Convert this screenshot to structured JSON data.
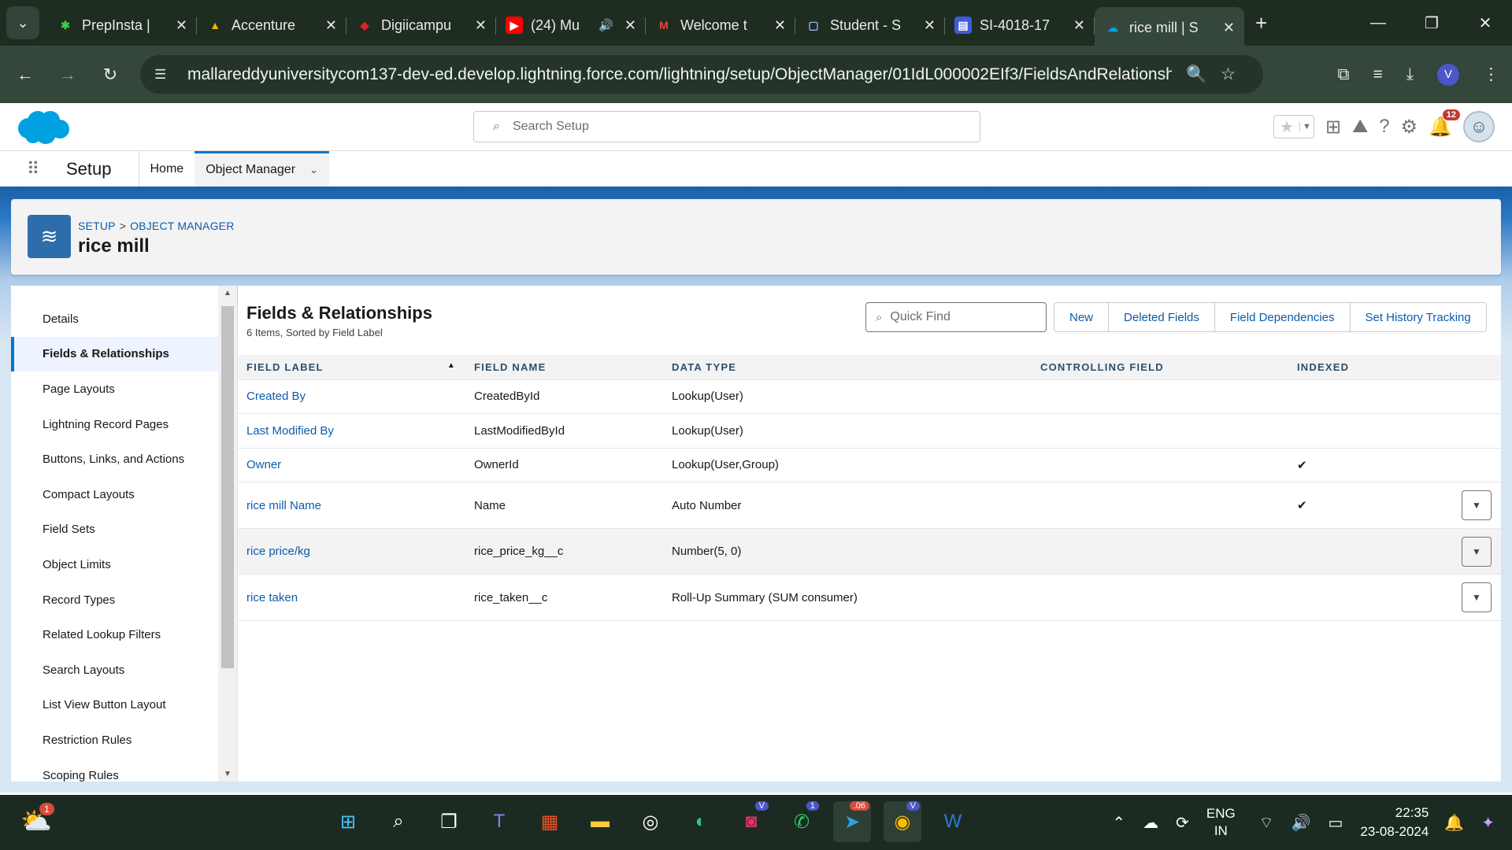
{
  "browser": {
    "tabs": [
      {
        "label": "PrepInsta |",
        "fav": "✱",
        "fav_color": "#3ecf4a",
        "fav_bg": "transparent"
      },
      {
        "label": "Accenture",
        "fav": "▲",
        "fav_color": "#f4b400",
        "fav_bg": "transparent"
      },
      {
        "label": "Digiicampu",
        "fav": "◆",
        "fav_color": "#e01e2a",
        "fav_bg": "transparent"
      },
      {
        "label": "(24) Mu",
        "fav": "▶",
        "fav_color": "#ffffff",
        "fav_bg": "#ff0000",
        "audio": "🔊"
      },
      {
        "label": "Welcome t",
        "fav": "M",
        "fav_color": "#ea4335",
        "fav_bg": "transparent"
      },
      {
        "label": "Student - S",
        "fav": "▢",
        "fav_color": "#8ab4f8",
        "fav_bg": "transparent"
      },
      {
        "label": "SI-4018-17",
        "fav": "▤",
        "fav_color": "#ffffff",
        "fav_bg": "#3b5bdb"
      },
      {
        "label": "rice mill | S",
        "fav": "☁",
        "fav_color": "#00a1e0",
        "fav_bg": "transparent"
      }
    ],
    "close_glyph": "✕",
    "new_tab": "+",
    "url": "mallareddyuniversitycom137-dev-ed.develop.lightning.force.com/lightning/setup/ObjectManager/01IdL000002EIf3/FieldsAndRelationships/view",
    "profile_initial": "V"
  },
  "salesforce": {
    "search_placeholder": "Search Setup",
    "notification_count": "12",
    "setup_label": "Setup",
    "nav_home": "Home",
    "nav_object_manager": "Object Manager",
    "breadcrumb_setup": "SETUP",
    "breadcrumb_sep": ">",
    "breadcrumb_object_manager": "OBJECT MANAGER",
    "object_title": "rice mill",
    "sidebar": [
      "Details",
      "Fields & Relationships",
      "Page Layouts",
      "Lightning Record Pages",
      "Buttons, Links, and Actions",
      "Compact Layouts",
      "Field Sets",
      "Object Limits",
      "Record Types",
      "Related Lookup Filters",
      "Search Layouts",
      "List View Button Layout",
      "Restriction Rules",
      "Scoping Rules"
    ],
    "panel_title": "Fields & Relationships",
    "panel_subtitle": "6 Items, Sorted by Field Label",
    "quick_find_placeholder": "Quick Find",
    "buttons": {
      "new": "New",
      "deleted_fields": "Deleted Fields",
      "field_dependencies": "Field Dependencies",
      "set_history_tracking": "Set History Tracking"
    },
    "columns": {
      "field_label": "FIELD LABEL",
      "field_name": "FIELD NAME",
      "data_type": "DATA TYPE",
      "controlling_field": "CONTROLLING FIELD",
      "indexed": "INDEXED"
    },
    "rows": [
      {
        "label": "Created By",
        "name": "CreatedById",
        "type": "Lookup(User)",
        "controlling": "",
        "indexed": ""
      },
      {
        "label": "Last Modified By",
        "name": "LastModifiedById",
        "type": "Lookup(User)",
        "controlling": "",
        "indexed": ""
      },
      {
        "label": "Owner",
        "name": "OwnerId",
        "type": "Lookup(User,Group)",
        "controlling": "",
        "indexed": "✔"
      },
      {
        "label": "rice mill Name",
        "name": "Name",
        "type": "Auto Number",
        "controlling": "",
        "indexed": "✔"
      },
      {
        "label": "rice price/kg",
        "name": "rice_price_kg__c",
        "type": "Number(5, 0)",
        "controlling": "",
        "indexed": ""
      },
      {
        "label": "rice taken",
        "name": "rice_taken__c",
        "type": "Roll-Up Summary (SUM consumer)",
        "controlling": "",
        "indexed": ""
      }
    ]
  },
  "taskbar": {
    "weather_badge": "1",
    "teams_badge": "V",
    "whatsapp_badge": "1",
    "telegram_badge": ".06",
    "chrome_badge": "V",
    "lang_top": "ENG",
    "lang_bottom": "IN",
    "time": "22:35",
    "date": "23-08-2024"
  }
}
